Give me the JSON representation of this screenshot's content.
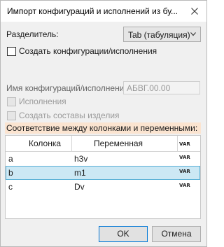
{
  "window": {
    "title": "Импорт конфигураций и исполнений из бу..."
  },
  "separator": {
    "label": "Разделитель:",
    "value": "Tab (табуляция)"
  },
  "create_configs": {
    "label": "Создать конфигурации/исполнения",
    "checked": false
  },
  "config_name": {
    "label": "Имя конфигураций/исполнений:",
    "placeholder": "АБВГ.00.00"
  },
  "executions": {
    "label": "Исполнения",
    "enabled": false
  },
  "create_assemblies": {
    "label": "Создать составы изделия",
    "enabled": false
  },
  "mapping": {
    "title": "Соответствие между колонками и переменными:",
    "columns": [
      "Колонка",
      "Переменная"
    ],
    "var_badge": "VAR",
    "rows": [
      {
        "column": "a",
        "variable": "h3v",
        "selected": false
      },
      {
        "column": "b",
        "variable": "m1",
        "selected": true
      },
      {
        "column": "c",
        "variable": "Dv",
        "selected": false
      }
    ]
  },
  "buttons": {
    "ok": "OK",
    "cancel": "Отмена"
  },
  "colors": {
    "section_bar": "#fbe4d0",
    "selection": "#cce8f4",
    "default_border": "#0078d7"
  }
}
